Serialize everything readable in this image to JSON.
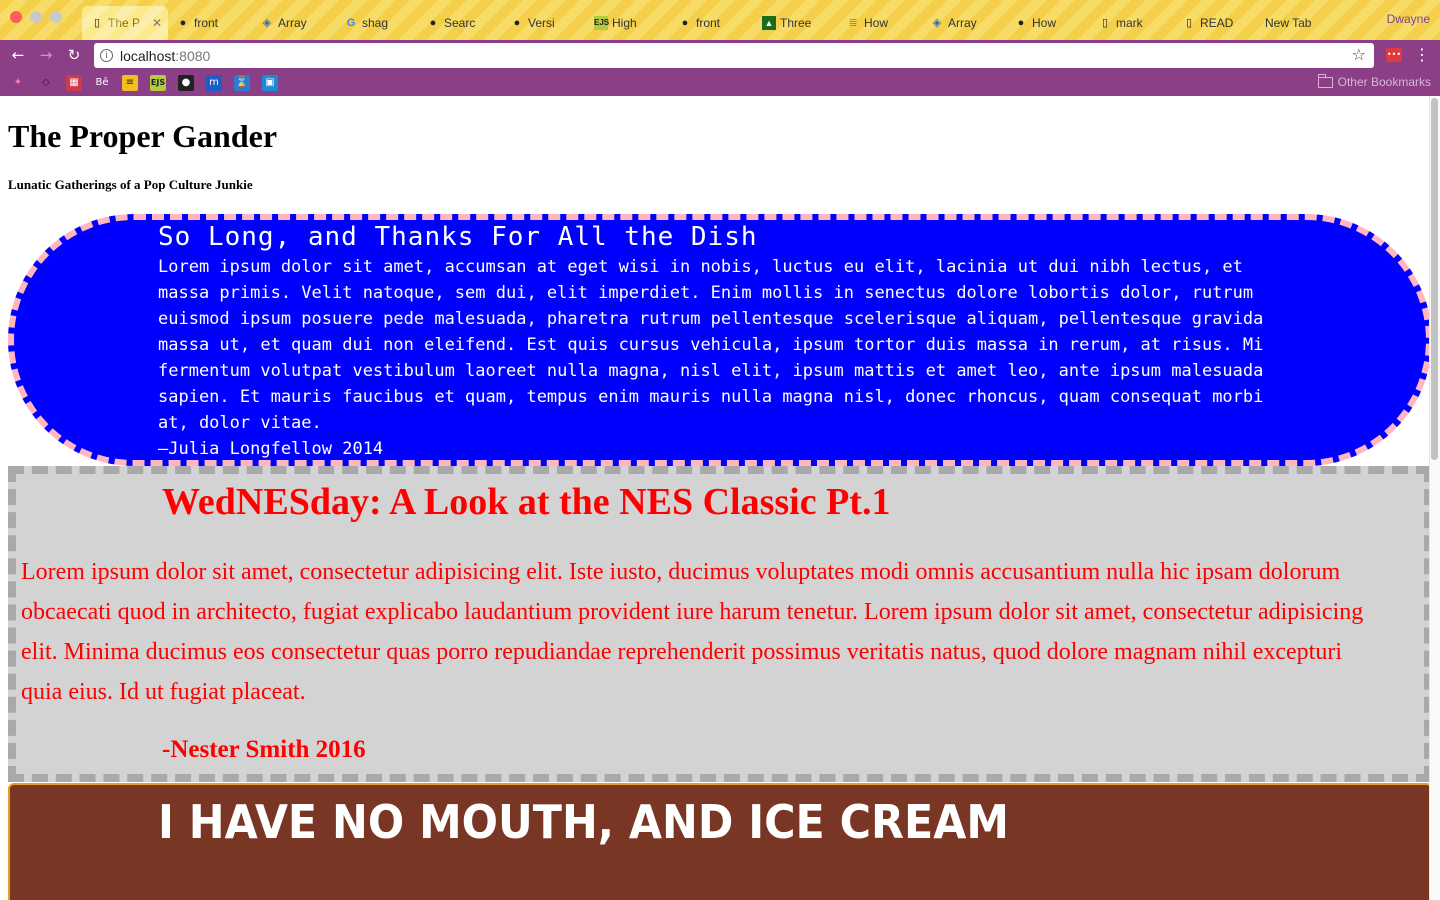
{
  "browser": {
    "profile_name": "Dwayne",
    "tabs": [
      {
        "label": "The P",
        "icon": "page-icon",
        "active": true
      },
      {
        "label": "front",
        "icon": "github-icon"
      },
      {
        "label": "Array",
        "icon": "bookmark-icon"
      },
      {
        "label": "shag",
        "icon": "google-icon"
      },
      {
        "label": "Searc",
        "icon": "github-icon"
      },
      {
        "label": "Versi",
        "icon": "github-icon"
      },
      {
        "label": "High",
        "icon": "ejs-icon"
      },
      {
        "label": "front",
        "icon": "github-icon"
      },
      {
        "label": "Three",
        "icon": "triangle-icon"
      },
      {
        "label": "How",
        "icon": "stack-icon"
      },
      {
        "label": "Array",
        "icon": "bookmark-icon"
      },
      {
        "label": "How",
        "icon": "apple-icon"
      },
      {
        "label": "mark",
        "icon": "page-icon"
      },
      {
        "label": "READ",
        "icon": "page-icon"
      },
      {
        "label": "New Tab",
        "icon": ""
      }
    ],
    "url": {
      "host": "localhost",
      "port": ":8080"
    },
    "bookmarks_other": "Other Bookmarks"
  },
  "site": {
    "title": "The Proper Gander",
    "subtitle": "Lunatic Gatherings of a Pop Culture Junkie"
  },
  "posts": [
    {
      "title": "So Long, and Thanks For All the Dish",
      "body": "Lorem ipsum dolor sit amet, accumsan at eget wisi in nobis, luctus eu elit, lacinia ut dui nibh lectus, et massa primis. Velit natoque, sem dui, elit imperdiet. Enim mollis in senectus dolore lobortis dolor, rutrum euismod ipsum posuere pede malesuada, pharetra rutrum pellentesque scelerisque aliquam, pellentesque gravida massa ut, et quam dui non eleifend. Est quis cursus vehicula, ipsum tortor duis massa in rerum, at risus. Mi fermentum volutpat vestibulum laoreet nulla magna, nisl elit, ipsum mattis et amet leo, ante ipsum malesuada sapien. Et mauris faucibus et quam, tempus enim mauris nulla magna nisl, donec rhoncus, quam consequat morbi at, dolor vitae.",
      "byline": "—Julia Longfellow 2014"
    },
    {
      "title": "WedNESday: A Look at the NES Classic Pt.1",
      "body": "Lorem ipsum dolor sit amet, consectetur adipisicing elit. Iste iusto, ducimus voluptates modi omnis accusantium nulla hic ipsam dolorum obcaecati quod in architecto, fugiat explicabo laudantium provident iure harum tenetur. Lorem ipsum dolor sit amet, consectetur adipisicing elit. Minima ducimus eos consectetur quas porro repudiandae reprehenderit possimus veritatis natus, quod dolore magnam nihil excepturi quia eius. Id ut fugiat placeat.",
      "byline": "-Nester Smith 2016"
    },
    {
      "title": "I Have No Mouth, and Ice Cream"
    }
  ]
}
